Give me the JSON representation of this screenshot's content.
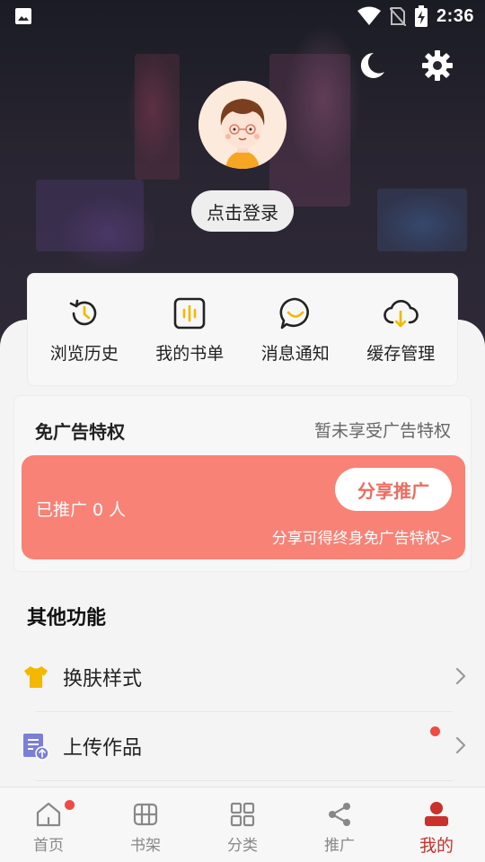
{
  "status_bar": {
    "time": "2:36"
  },
  "profile": {
    "login_label": "点击登录"
  },
  "quick_actions": [
    {
      "label": "浏览历史",
      "icon": "history-icon"
    },
    {
      "label": "我的书单",
      "icon": "booklist-icon"
    },
    {
      "label": "消息通知",
      "icon": "message-icon"
    },
    {
      "label": "缓存管理",
      "icon": "cloud-download-icon"
    }
  ],
  "ad_free": {
    "title": "免广告特权",
    "status": "暂未享受广告特权",
    "promoted_count": "已推广 0 人",
    "share_button": "分享推广",
    "share_hint": "分享可得终身免广告特权>"
  },
  "other_functions": {
    "title": "其他功能",
    "items": [
      {
        "label": "换肤样式",
        "icon": "tshirt-icon"
      },
      {
        "label": "上传作品",
        "icon": "upload-doc-icon",
        "badge": true
      }
    ]
  },
  "bottom_nav": [
    {
      "label": "首页",
      "icon": "home-icon",
      "badge": true
    },
    {
      "label": "书架",
      "icon": "bookshelf-icon"
    },
    {
      "label": "分类",
      "icon": "category-icon"
    },
    {
      "label": "推广",
      "icon": "share-icon"
    },
    {
      "label": "我的",
      "icon": "person-icon",
      "active": true
    }
  ],
  "colors": {
    "accent": "#c8322b",
    "promo_bg": "#f98277",
    "share_text": "#f06a5e",
    "icon_yellow": "#f5b800",
    "icon_purple": "#7b7fd6"
  }
}
